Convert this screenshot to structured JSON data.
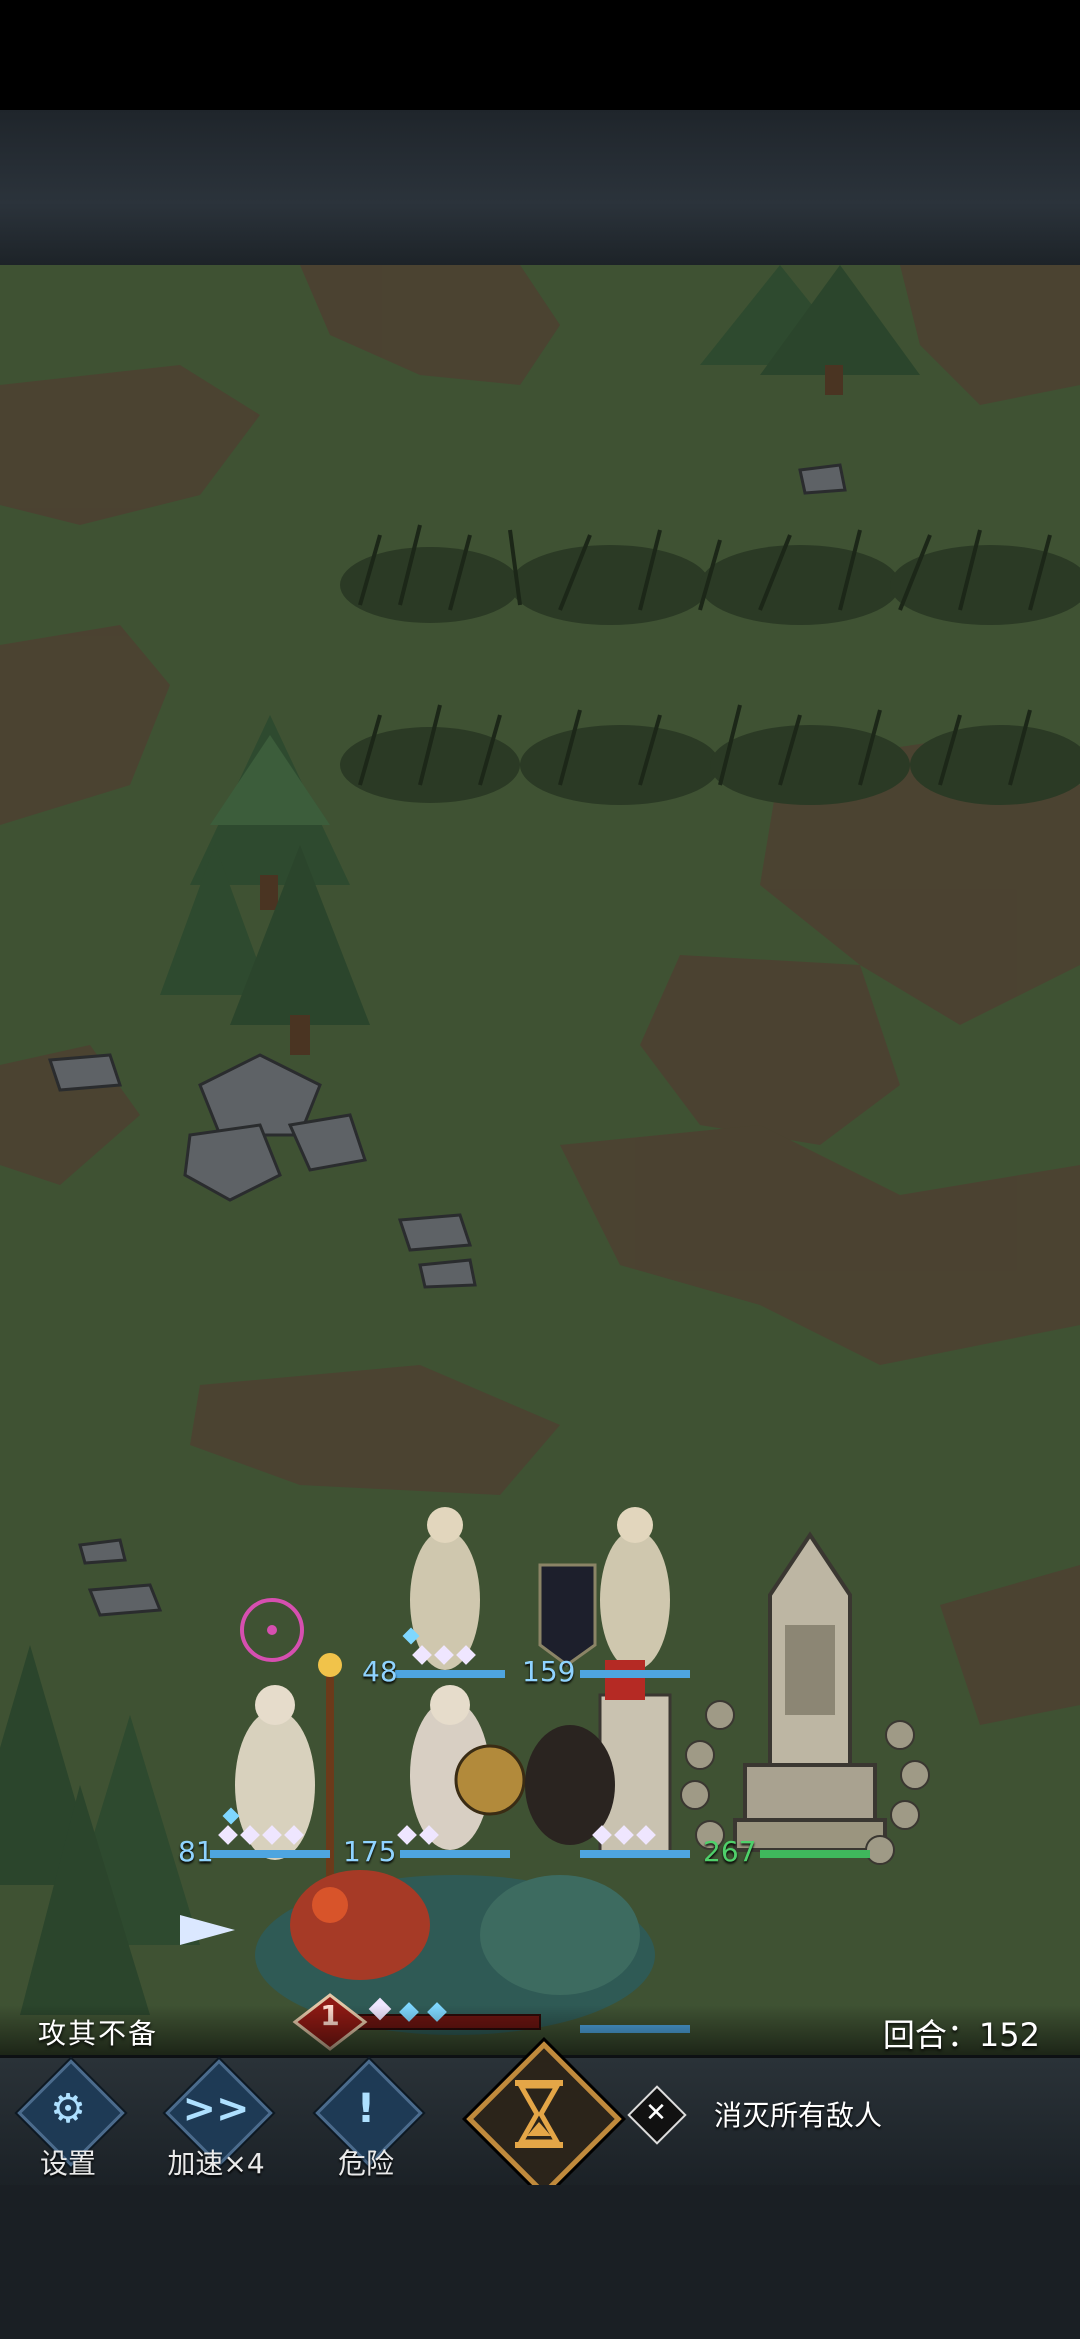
{
  "status": {
    "event_text": "攻其不备",
    "round_label": "回合：152",
    "turn_badge": "1"
  },
  "units": {
    "hp_labels": [
      "48",
      "159",
      "81",
      "175",
      "267"
    ]
  },
  "controls": {
    "settings": "设置",
    "speed": "加速×4",
    "speed_icon": ">>",
    "danger": "危险",
    "danger_icon": "!"
  },
  "objective": {
    "text": "消灭所有敌人"
  },
  "colors": {
    "grass": "#3f5233",
    "dirt": "#4a3f30",
    "ally_hp": "#8fd3ff",
    "neutral_hp": "#4fd06a",
    "enemy_accent": "#b52a24",
    "hourglass_gold": "#c08a3c"
  }
}
